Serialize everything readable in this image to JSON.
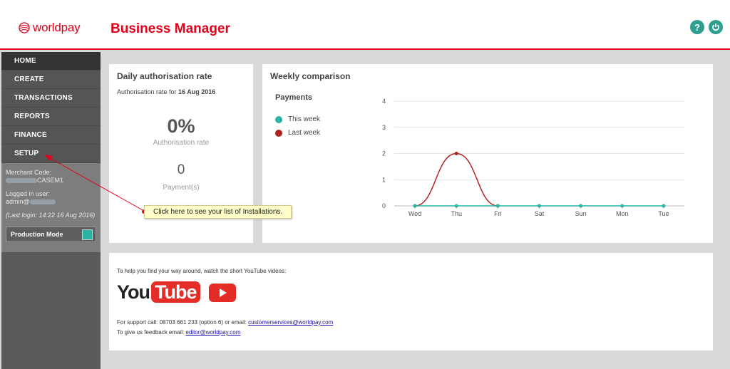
{
  "header": {
    "logo_text": "worldpay",
    "app_title": "Business Manager",
    "help_icon": "question-icon",
    "power_icon": "power-icon",
    "accent": "#e2001a",
    "teal": "#2e9e8f"
  },
  "sidebar": {
    "items": [
      {
        "label": "HOME"
      },
      {
        "label": "CREATE"
      },
      {
        "label": "TRANSACTIONS"
      },
      {
        "label": "REPORTS"
      },
      {
        "label": "FINANCE"
      },
      {
        "label": "SETUP"
      }
    ],
    "merchant_code_label": "Merchant Code:",
    "merchant_code_suffix": "CASEM1",
    "logged_in_label": "Logged in user:",
    "logged_in_prefix": "admin@",
    "last_login": "(Last login: 14:22 16 Aug 2016)",
    "production_mode_label": "Production Mode"
  },
  "daily": {
    "title": "Daily authorisation rate",
    "subtitle_prefix": "Authorisation rate for ",
    "subtitle_date": "16 Aug 2016",
    "rate_value": "0%",
    "rate_label": "Authorisation rate",
    "payments_value": "0",
    "payments_label": "Payment(s)"
  },
  "weekly": {
    "title": "Weekly comparison",
    "section_label": "Payments"
  },
  "chart_data": {
    "type": "line",
    "categories": [
      "Wed",
      "Thu",
      "Fri",
      "Sat",
      "Sun",
      "Mon",
      "Tue"
    ],
    "series": [
      {
        "name": "This week",
        "color": "#2bb3a4",
        "values": [
          0,
          0,
          0,
          0,
          0,
          0,
          0
        ]
      },
      {
        "name": "Last week",
        "color": "#b22222",
        "values": [
          0,
          2,
          0,
          null,
          null,
          null,
          null
        ]
      }
    ],
    "yticks": [
      "0",
      "1",
      "2",
      "3",
      "4"
    ],
    "ylim": [
      0,
      4
    ],
    "grid": true,
    "legend": "left"
  },
  "videos": {
    "intro": "To help you find your way around, watch the short YouTube videos:",
    "youtube_you": "You",
    "youtube_tube": "Tube",
    "support_text": "For support call: 08703 661 233 (option 6) or email: ",
    "support_email": "customerservices@worldpay.com",
    "feedback_text": "To give us feedback email: ",
    "feedback_email": "editor@worldpay.com"
  },
  "tooltip": {
    "text": "Click here to see your list of Installations."
  }
}
